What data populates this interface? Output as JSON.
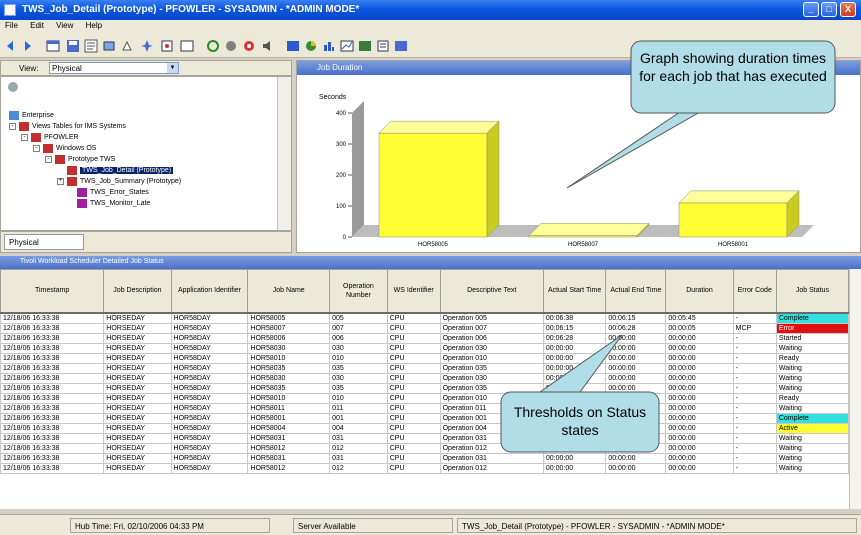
{
  "window": {
    "title": "TWS_Job_Detail (Prototype) - PFOWLER - SYSADMIN - *ADMIN MODE*",
    "minimize": "_",
    "restore": "□",
    "close": "X"
  },
  "menu": [
    "File",
    "Edit",
    "View",
    "Help"
  ],
  "view_panel": {
    "label": "View:",
    "selected_view": "Physical",
    "tab_label": "Physical"
  },
  "tree": [
    {
      "label": "Enterprise"
    },
    {
      "label": "Views Tables for IMS Systems"
    },
    {
      "label": "PFOWLER"
    },
    {
      "label": "Windows OS"
    },
    {
      "label": "Prototype TWS"
    },
    {
      "label": "TWS_Job_Detail (Prototype)"
    },
    {
      "label": "TWS_Job_Summary (Prototype)"
    },
    {
      "label": "TWS_Error_States"
    },
    {
      "label": "TWS_Monitor_Late"
    }
  ],
  "chart_panel_title": "Job Duration",
  "chart_data": {
    "type": "bar",
    "ylabel": "Seconds",
    "ylim": [
      0,
      400
    ],
    "yticks": [
      0,
      100,
      200,
      300,
      400
    ],
    "categories": [
      "HOR58005",
      "HOR58007",
      "HOR58001"
    ],
    "values": [
      335,
      5,
      110
    ],
    "bar_color": "#ffff33"
  },
  "grid": {
    "title": "Tivoli Workload Scheduler Detailed Job Status",
    "columns": [
      "Timestamp",
      "Job Description",
      "Application Identifier",
      "Job Name",
      "Operation Number",
      "WS Identifier",
      "Descriptive Text",
      "Actual Start Time",
      "Actual End Time",
      "Duration",
      "Error Code",
      "Job Status"
    ],
    "rows": [
      [
        "12/18/06 16:33:38",
        "HORSEDAY",
        "HOR58DAY",
        "HOR58005",
        "005",
        "CPU",
        "Operation 005",
        "00:06:38",
        "00:06:15",
        "00:05:45",
        "-",
        "Complete"
      ],
      [
        "12/18/06 16:33:38",
        "HORSEDAY",
        "HOR58DAY",
        "HOR58007",
        "007",
        "CPU",
        "Operation 007",
        "00:06:15",
        "00:06:28",
        "00:00:05",
        "MCP",
        "Error"
      ],
      [
        "12/18/06 16:33:38",
        "HORSEDAY",
        "HOR58DAY",
        "HOR58006",
        "006",
        "CPU",
        "Operation 006",
        "00:06:28",
        "00:00:00",
        "00:00:00",
        "-",
        "Started"
      ],
      [
        "12/18/06 16:33:38",
        "HORSEDAY",
        "HOR58DAY",
        "HOR58030",
        "030",
        "CPU",
        "Operation 030",
        "00:00:00",
        "00:00:00",
        "00:00:00",
        "-",
        "Waiting"
      ],
      [
        "12/18/06 16:33:38",
        "HORSEDAY",
        "HOR58DAY",
        "HOR58010",
        "010",
        "CPU",
        "Operation 010",
        "00:00:00",
        "00:00:00",
        "00:00:00",
        "-",
        "Ready"
      ],
      [
        "12/18/06 16:33:38",
        "HORSEDAY",
        "HOR58DAY",
        "HOR58035",
        "035",
        "CPU",
        "Operation 035",
        "00:00:00",
        "00:00:00",
        "00:00:00",
        "-",
        "Waiting"
      ],
      [
        "12/18/06 16:33:38",
        "HORSEDAY",
        "HOR58DAY",
        "HOR58030",
        "030",
        "CPU",
        "Operation 030",
        "00:00:00",
        "00:00:00",
        "00:00:00",
        "-",
        "Waiting"
      ],
      [
        "12/18/06 16:33:38",
        "HORSEDAY",
        "HOR58DAY",
        "HOR58035",
        "035",
        "CPU",
        "Operation 035",
        "00:00:00",
        "00:00:00",
        "00:00:00",
        "-",
        "Waiting"
      ],
      [
        "12/18/06 16:33:38",
        "HORSEDAY",
        "HOR58DAY",
        "HOR58010",
        "010",
        "CPU",
        "Operation 010",
        "00:00:00",
        "00:00:00",
        "00:00:00",
        "-",
        "Ready"
      ],
      [
        "12/18/06 16:33:38",
        "HORSEDAY",
        "HOR58DAY",
        "HOR58011",
        "011",
        "CPU",
        "Operation 011",
        "00:00:00",
        "00:00:00",
        "00:00:00",
        "-",
        "Waiting"
      ],
      [
        "12/18/06 16:33:38",
        "HORSEDAY",
        "HOR58DAY",
        "HOR58001",
        "001",
        "CPU",
        "Operation 001",
        "00:00:00",
        "00:00:00",
        "00:00:00",
        "-",
        "Complete"
      ],
      [
        "12/18/06 16:33:38",
        "HORSEDAY",
        "HOR58DAY",
        "HOR58004",
        "004",
        "CPU",
        "Operation 004",
        "00:00:00",
        "00:00:00",
        "00:00:00",
        "-",
        "Active"
      ],
      [
        "12/18/06 16:33:38",
        "HORSEDAY",
        "HOR58DAY",
        "HOR58031",
        "031",
        "CPU",
        "Operation 031",
        "00:00:00",
        "00:00:00",
        "00:00:00",
        "-",
        "Waiting"
      ],
      [
        "12/18/06 16:33:38",
        "HORSEDAY",
        "HOR58DAY",
        "HOR58012",
        "012",
        "CPU",
        "Operation 012",
        "00:00:00",
        "00:00:00",
        "00:00:00",
        "-",
        "Waiting"
      ],
      [
        "12/18/06 16:33:38",
        "HORSEDAY",
        "HOR58DAY",
        "HOR58031",
        "031",
        "CPU",
        "Operation 031",
        "00:00:00",
        "00:00:00",
        "00:00:00",
        "-",
        "Waiting"
      ],
      [
        "12/18/06 16:33:38",
        "HORSEDAY",
        "HOR58DAY",
        "HOR58012",
        "012",
        "CPU",
        "Operation 012",
        "00:00:00",
        "00:00:00",
        "00:00:00",
        "-",
        "Waiting"
      ]
    ],
    "status_colors": {
      "Complete": "#33e0e0",
      "Error": "#e01010",
      "Active": "#ffff33"
    }
  },
  "statusbar": {
    "hub_time": "Hub Time: Fri, 02/10/2006 04:33 PM",
    "server": "Server Available",
    "workspace": "TWS_Job_Detail (Prototype) - PFOWLER - SYSADMIN - *ADMIN MODE*"
  },
  "callouts": {
    "graph": "Graph showing duration times for each job that has executed",
    "thresholds": "Thresholds on Status states"
  }
}
